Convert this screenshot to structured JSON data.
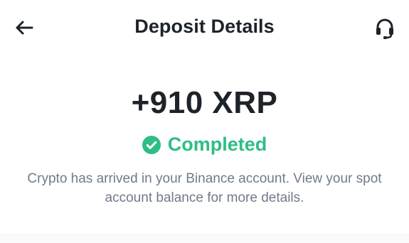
{
  "header": {
    "back_icon": "arrow-left-icon",
    "title": "Deposit Details",
    "support_icon": "headset-icon"
  },
  "deposit": {
    "amount": "+910 XRP",
    "status_icon": "check-circle-icon",
    "status": "Completed",
    "message": "Crypto has arrived in your Binance account. View your spot account balance for more details."
  },
  "colors": {
    "text_primary": "#1e2329",
    "text_secondary": "#707a8a",
    "success": "#2ebd85"
  }
}
